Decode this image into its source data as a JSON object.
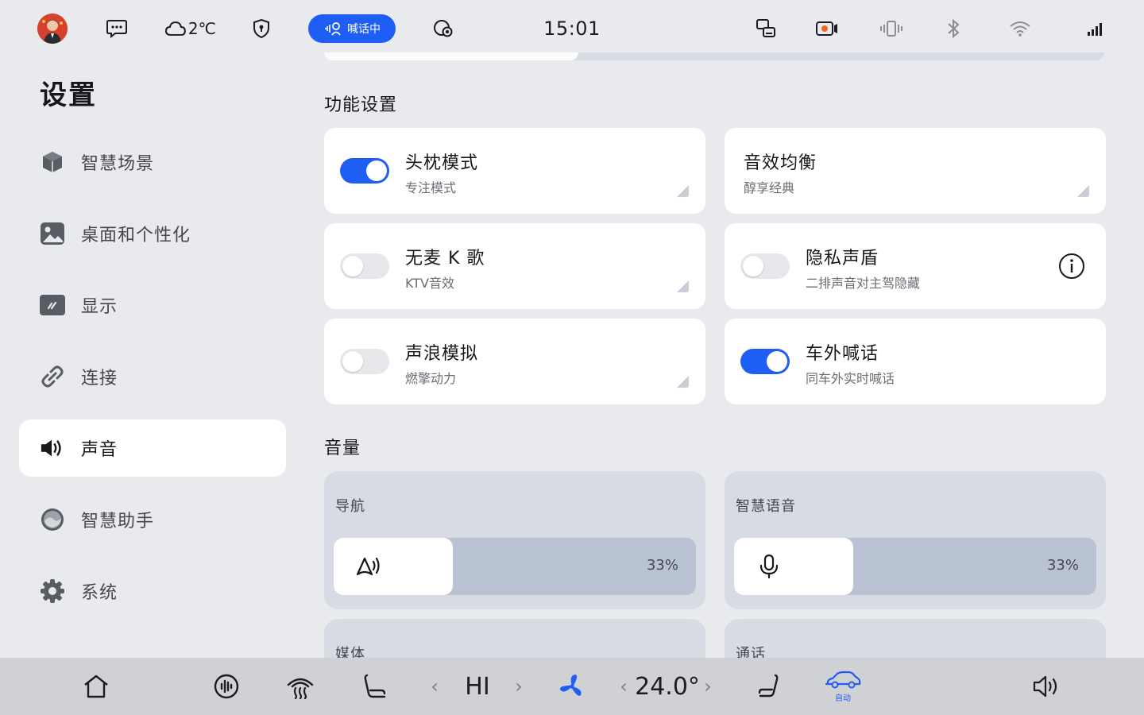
{
  "status_bar": {
    "weather_temp": "2℃",
    "shout_label": "喊话中",
    "time": "15:01"
  },
  "sidebar": {
    "title": "设置",
    "items": [
      {
        "label": "智慧场景",
        "icon": "cube-icon"
      },
      {
        "label": "桌面和个性化",
        "icon": "image-icon"
      },
      {
        "label": "显示",
        "icon": "display-icon"
      },
      {
        "label": "连接",
        "icon": "link-icon"
      },
      {
        "label": "声音",
        "icon": "speaker-icon",
        "active": true
      },
      {
        "label": "智慧助手",
        "icon": "assistant-icon"
      },
      {
        "label": "系统",
        "icon": "gear-icon"
      }
    ]
  },
  "function_settings": {
    "title": "功能设置",
    "cards": [
      {
        "title": "头枕模式",
        "subtitle": "专注模式",
        "toggle": true
      },
      {
        "title": "音效均衡",
        "subtitle": "醇享经典"
      },
      {
        "title": "无麦 K 歌",
        "subtitle": "KTV音效",
        "toggle": false
      },
      {
        "title": "隐私声盾",
        "subtitle": "二排声音对主驾隐藏",
        "toggle": false
      },
      {
        "title": "声浪模拟",
        "subtitle": "燃擎动力",
        "toggle": false
      },
      {
        "title": "车外喊话",
        "subtitle": "同车外实时喊话",
        "toggle": true
      }
    ]
  },
  "volume": {
    "title": "音量",
    "channels": [
      {
        "label": "导航",
        "percent": "33%",
        "level": 0.33,
        "icon": "navigation-voice-icon"
      },
      {
        "label": "智慧语音",
        "percent": "33%",
        "level": 0.33,
        "icon": "microphone-icon"
      },
      {
        "label": "媒体"
      },
      {
        "label": "通话"
      }
    ]
  },
  "dock": {
    "fan_speed": "HI",
    "temperature": "24.0°",
    "auto_label": "自动"
  },
  "colors": {
    "accent": "#1f5ef5",
    "background": "#e9eaee",
    "dock": "#d0d1d5"
  }
}
